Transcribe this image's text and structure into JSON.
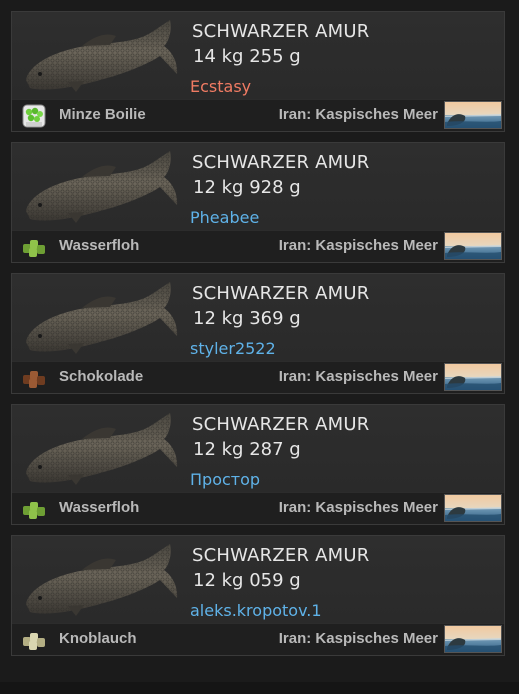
{
  "colors": {
    "player_orange": "#f07b63",
    "player_blue": "#5fb2e8",
    "text_primary": "#e6e6e6",
    "text_secondary": "#b9b9b9"
  },
  "entries": [
    {
      "species": "SCHWARZER AMUR",
      "weight": "14 kg 255 g",
      "player": "Ecstasy",
      "player_color": "#f07b63",
      "bait": "Minze Boilie",
      "bait_icon": "mint-boilie-jar-icon",
      "location": "Iran: Kaspisches Meer"
    },
    {
      "species": "SCHWARZER AMUR",
      "weight": "12 kg 928 g",
      "player": "Pheabee",
      "player_color": "#5fb2e8",
      "bait": "Wasserfloh",
      "bait_icon": "green-pellets-icon",
      "location": "Iran: Kaspisches Meer"
    },
    {
      "species": "SCHWARZER AMUR",
      "weight": "12 kg 369 g",
      "player": "styler2522",
      "player_color": "#5fb2e8",
      "bait": "Schokolade",
      "bait_icon": "brown-pellets-icon",
      "location": "Iran: Kaspisches Meer"
    },
    {
      "species": "SCHWARZER AMUR",
      "weight": "12 kg 287 g",
      "player": "Простор",
      "player_color": "#5fb2e8",
      "bait": "Wasserfloh",
      "bait_icon": "green-pellets-icon",
      "location": "Iran: Kaspisches Meer"
    },
    {
      "species": "SCHWARZER AMUR",
      "weight": "12 kg 059 g",
      "player": "aleks.kropotov.1",
      "player_color": "#5fb2e8",
      "bait": "Knoblauch",
      "bait_icon": "garlic-pellets-icon",
      "location": "Iran: Kaspisches Meer"
    }
  ]
}
